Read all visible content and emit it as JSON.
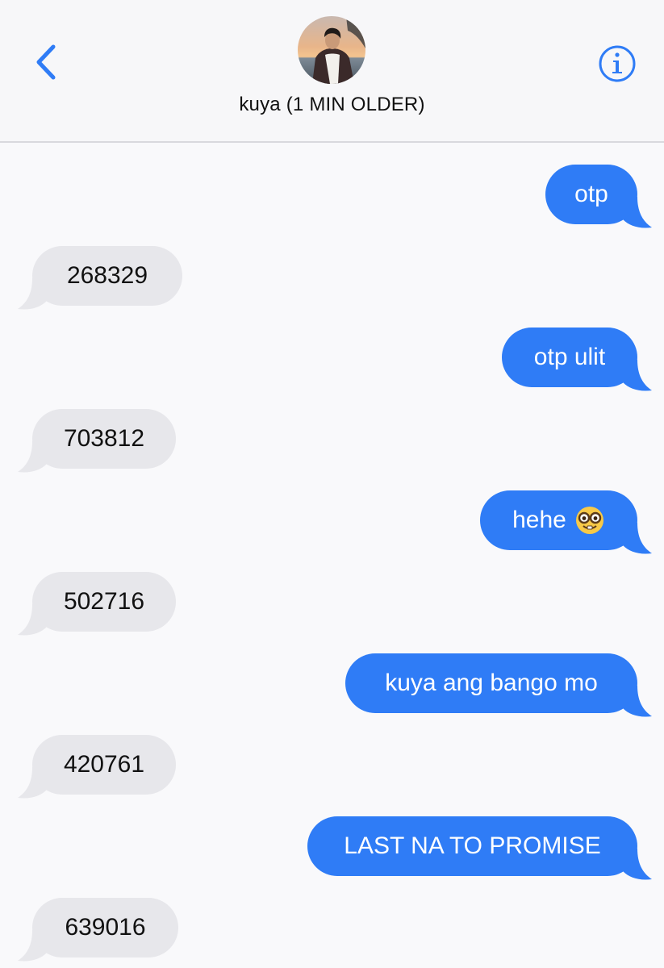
{
  "header": {
    "contact_name": "kuya (1 MIN OLDER)",
    "back_icon": "chevron-left-icon",
    "info_icon": "info-circle-icon",
    "accent_color": "#2f7cf6"
  },
  "colors": {
    "sent_bubble": "#2f7cf6",
    "received_bubble": "#e7e7eb",
    "background": "#f9f9fb"
  },
  "messages": [
    {
      "direction": "sent",
      "text": "otp"
    },
    {
      "direction": "received",
      "text": "268329"
    },
    {
      "direction": "sent",
      "text": "otp ulit"
    },
    {
      "direction": "received",
      "text": "703812"
    },
    {
      "direction": "sent",
      "text": "hehe",
      "emoji": "nerd-face-emoji"
    },
    {
      "direction": "received",
      "text": "502716"
    },
    {
      "direction": "sent",
      "text": "kuya ang bango mo"
    },
    {
      "direction": "received",
      "text": "420761"
    },
    {
      "direction": "sent",
      "text": "LAST NA TO PROMISE"
    },
    {
      "direction": "received",
      "text": "639016"
    }
  ]
}
